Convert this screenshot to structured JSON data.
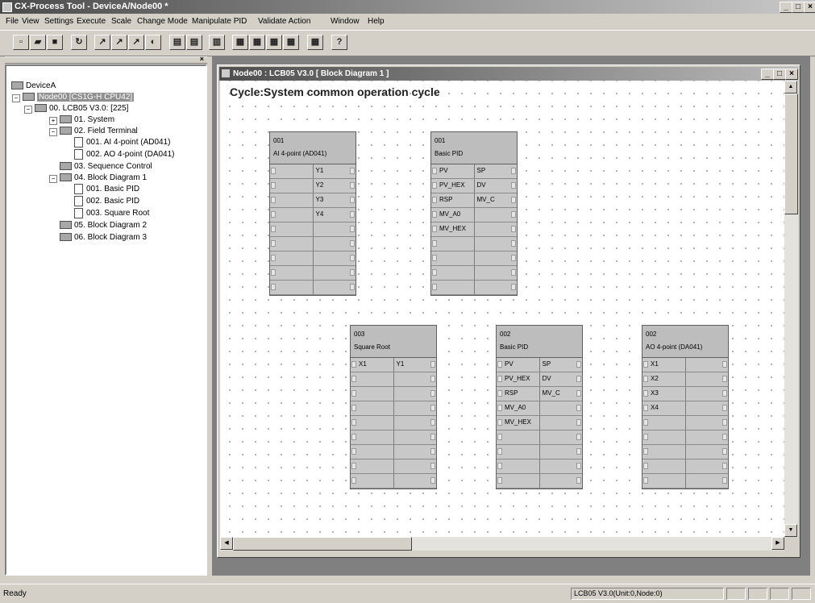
{
  "window": {
    "title": "CX-Process Tool - DeviceA/Node00 *",
    "min": "_",
    "max": "□",
    "close": "×"
  },
  "menu": [
    "File",
    "View",
    "Settings",
    "Execute",
    "Scale",
    "Change Mode",
    "Manipulate PID",
    "Validate Action",
    "Window",
    "Help"
  ],
  "toolbar": {
    "help_label": "?"
  },
  "tree": {
    "items": [
      {
        "label": "DeviceA"
      },
      {
        "label": "Node00 [CS1G-H CPU42]"
      },
      {
        "label": "00. LCB05 V3.0: [225]"
      },
      {
        "label": "01. System"
      },
      {
        "label": "02. Field Terminal"
      },
      {
        "label": "001. AI 4-point (AD041)"
      },
      {
        "label": "002. AO 4-point (DA041)"
      },
      {
        "label": "03. Sequence Control"
      },
      {
        "label": "04. Block Diagram 1"
      },
      {
        "label": "001. Basic PID"
      },
      {
        "label": "002. Basic PID"
      },
      {
        "label": "003. Square Root"
      },
      {
        "label": "05. Block Diagram 2"
      },
      {
        "label": "06. Block Diagram 3"
      }
    ]
  },
  "child": {
    "title": "Node00 : LCB05 V3.0 [ Block Diagram 1 ]",
    "cycle_label": "Cycle:System common operation cycle",
    "min": "_",
    "max": "□",
    "close": "×"
  },
  "blocks": [
    {
      "num": "001",
      "name": "AI 4-point (AD041)",
      "rows": [
        [
          "",
          "Y1"
        ],
        [
          "",
          "Y2"
        ],
        [
          "",
          "Y3"
        ],
        [
          "",
          "Y4"
        ],
        [
          "",
          ""
        ],
        [
          "",
          ""
        ],
        [
          "",
          ""
        ],
        [
          "",
          ""
        ],
        [
          "",
          ""
        ]
      ]
    },
    {
      "num": "001",
      "name": "Basic PID",
      "rows": [
        [
          "PV",
          "SP"
        ],
        [
          "PV_HEX",
          "DV"
        ],
        [
          "RSP",
          "MV_C"
        ],
        [
          "MV_A0",
          ""
        ],
        [
          "MV_HEX",
          ""
        ],
        [
          "",
          ""
        ],
        [
          "",
          ""
        ],
        [
          "",
          ""
        ],
        [
          "",
          ""
        ]
      ]
    },
    {
      "num": "003",
      "name": "Square Root",
      "rows": [
        [
          "X1",
          "Y1"
        ],
        [
          "",
          ""
        ],
        [
          "",
          ""
        ],
        [
          "",
          ""
        ],
        [
          "",
          ""
        ],
        [
          "",
          ""
        ],
        [
          "",
          ""
        ],
        [
          "",
          ""
        ],
        [
          "",
          ""
        ]
      ]
    },
    {
      "num": "002",
      "name": "Basic PID",
      "rows": [
        [
          "PV",
          "SP"
        ],
        [
          "PV_HEX",
          "DV"
        ],
        [
          "RSP",
          "MV_C"
        ],
        [
          "MV_A0",
          ""
        ],
        [
          "MV_HEX",
          ""
        ],
        [
          "",
          ""
        ],
        [
          "",
          ""
        ],
        [
          "",
          ""
        ],
        [
          "",
          ""
        ]
      ]
    },
    {
      "num": "002",
      "name": "AO 4-point (DA041)",
      "rows": [
        [
          "X1",
          ""
        ],
        [
          "X2",
          ""
        ],
        [
          "X3",
          ""
        ],
        [
          "X4",
          ""
        ],
        [
          "",
          ""
        ],
        [
          "",
          ""
        ],
        [
          "",
          ""
        ],
        [
          "",
          ""
        ],
        [
          "",
          ""
        ]
      ]
    }
  ],
  "status": {
    "ready": "Ready",
    "node_info": "LCB05 V3.0(Unit:0,Node:0)"
  }
}
